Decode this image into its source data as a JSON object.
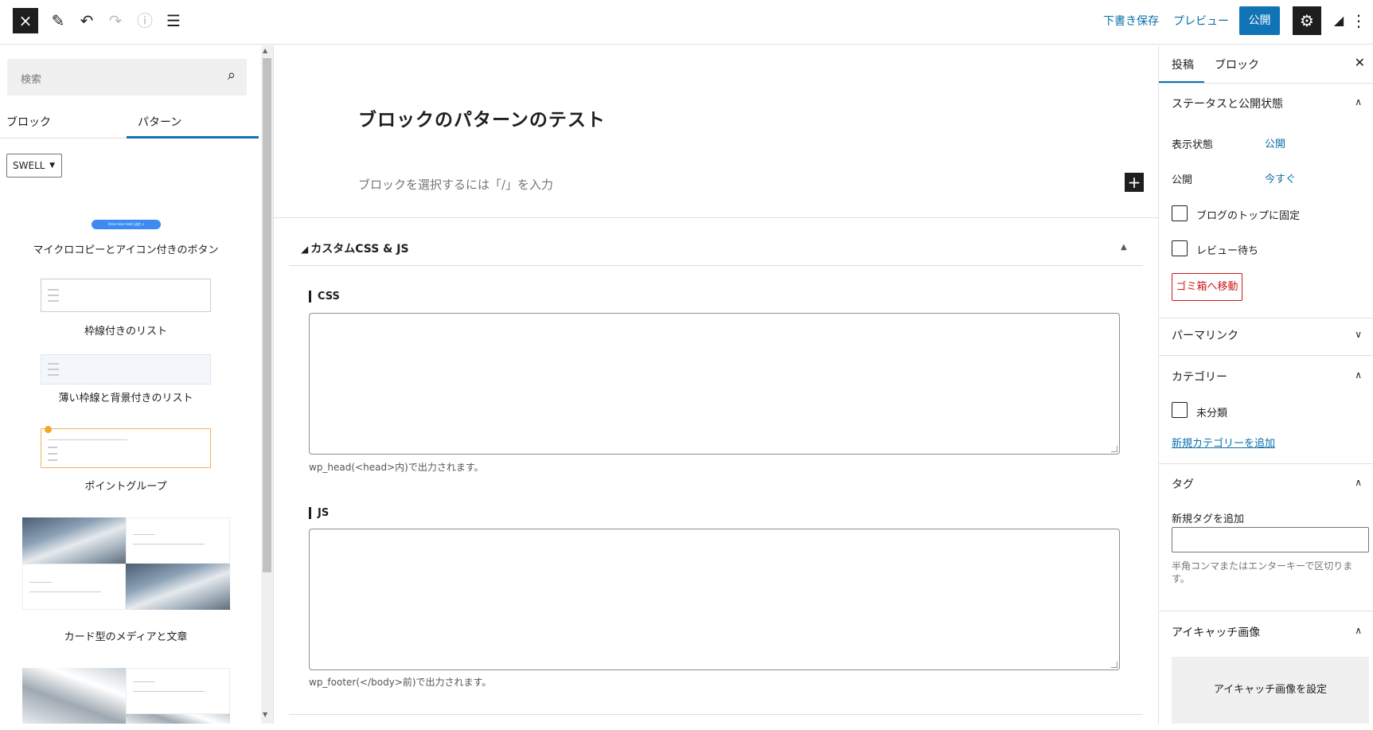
{
  "topbar": {
    "close_icon": "×",
    "pen_icon": "✎",
    "undo_icon": "↶",
    "redo_icon": "↷",
    "info_icon": "ⓘ",
    "list_icon": "☰",
    "save_draft": "下書き保存",
    "preview": "プレビュー",
    "publish": "公開",
    "settings_icon": "⚙",
    "swell_icon": "◢",
    "more_icon": "⋮"
  },
  "left": {
    "search_placeholder": "検索",
    "search_icon": "⌕",
    "tabs": [
      "ブロック",
      "パターン"
    ],
    "category": "SWELL",
    "patterns": [
      {
        "label": "マイクロコピーとアイコン付きのボタン",
        "mini_text": "[here here text] 送信 ∨"
      },
      {
        "label": "枠線付きのリスト"
      },
      {
        "label": "薄い枠線と背景付きのリスト"
      },
      {
        "label": "ポイントグループ"
      },
      {
        "label": "カード型のメディアと文章"
      }
    ]
  },
  "editor": {
    "title": "ブロックのパターンのテスト",
    "placeholder": "ブロックを選択するには「/」を入力",
    "add_icon": "+",
    "meta_title": "カスタムCSS & JS",
    "meta_logo": "◢",
    "caret_icon": "▲",
    "css_label": "CSS",
    "css_help": "wp_head(<head>内)で出力されます。",
    "js_label": "JS",
    "js_help": "wp_footer(</body>前)で出力されます。"
  },
  "sidebar": {
    "tabs": [
      "投稿",
      "ブロック"
    ],
    "close_icon": "✕",
    "status_title": "ステータスと公開状態",
    "visibility_label": "表示状態",
    "visibility_value": "公開",
    "publish_label": "公開",
    "publish_value": "今すぐ",
    "sticky_label": "ブログのトップに固定",
    "pending_label": "レビュー待ち",
    "trash": "ゴミ箱へ移動",
    "permalink_title": "パーマリンク",
    "category_title": "カテゴリー",
    "uncategorized": "未分類",
    "add_category": "新規カテゴリーを追加",
    "tags_title": "タグ",
    "add_tag_label": "新規タグを追加",
    "tag_help": "半角コンマまたはエンターキーで区切ります。",
    "featured_title": "アイキャッチ画像",
    "set_featured": "アイキャッチ画像を設定",
    "chev_up": "∧",
    "chev_down": "∨"
  },
  "colors": {
    "accent": "#0f73b5",
    "danger": "#cc1818",
    "dark": "#1e1e1e"
  }
}
